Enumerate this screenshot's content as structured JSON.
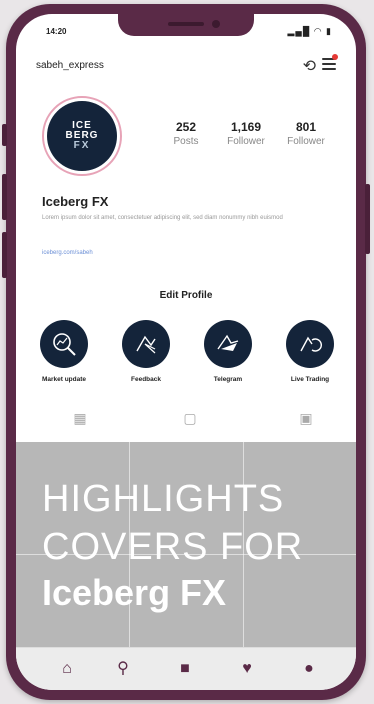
{
  "status": {
    "time": "14:20",
    "icons": "▂▄█ ◠ ▮"
  },
  "header": {
    "username": "sabeh_express",
    "history_icon": "history-icon",
    "menu_icon": "menu-icon"
  },
  "profile": {
    "avatar": {
      "line1": "ICE",
      "line2": "BERG",
      "line3": "FX"
    },
    "stats": [
      {
        "value": "252",
        "label": "Posts"
      },
      {
        "value": "1,169",
        "label": "Follower"
      },
      {
        "value": "801",
        "label": "Follower"
      }
    ],
    "name": "Iceberg FX",
    "bio": "Lorem ipsum dolor sit amet, consectetuer adipiscing elit, sed diam nonummy nibh euismod",
    "link": "iceberg.com/sabeh",
    "edit_label": "Edit Profile"
  },
  "highlights": [
    {
      "label": "Market update",
      "icon": "market-chart-icon"
    },
    {
      "label": "Feedback",
      "icon": "feedback-icon"
    },
    {
      "label": "Telegram",
      "icon": "telegram-icon"
    },
    {
      "label": "Live Trading",
      "icon": "live-trading-icon"
    }
  ],
  "tabs": [
    "grid-icon",
    "reels-icon",
    "tagged-icon"
  ],
  "post_grid": {
    "line1": "HIGHLIGHTS",
    "line2": "COVERS FOR",
    "line3": "Iceberg FX"
  },
  "bottom_nav": [
    "home-icon",
    "search-icon",
    "add-icon",
    "heart-icon",
    "profile-icon"
  ],
  "colors": {
    "frame": "#5a2a47",
    "avatar_bg": "#14243a",
    "grid_bg": "#b7b7b7"
  }
}
